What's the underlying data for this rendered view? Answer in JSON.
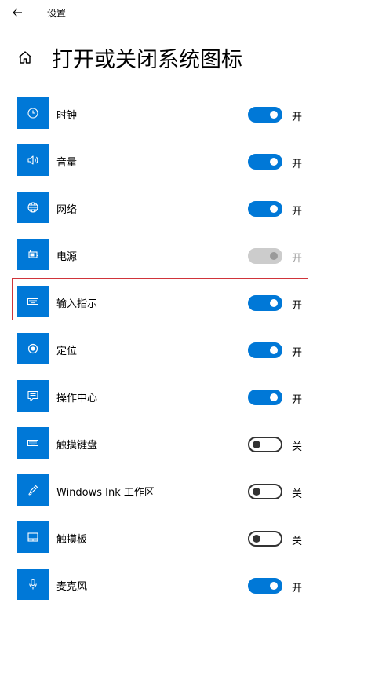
{
  "window": {
    "title": "设置"
  },
  "page": {
    "title": "打开或关闭系统图标"
  },
  "colors": {
    "accent": "#0078d7",
    "selection_border": "#d0343a",
    "disabled": "#cccccc"
  },
  "items": [
    {
      "label": "时钟",
      "icon": "clock-icon",
      "on": true,
      "disabled": false,
      "state": "开"
    },
    {
      "label": "音量",
      "icon": "volume-icon",
      "on": true,
      "disabled": false,
      "state": "开"
    },
    {
      "label": "网络",
      "icon": "network-globe-icon",
      "on": true,
      "disabled": false,
      "state": "开"
    },
    {
      "label": "电源",
      "icon": "battery-power-icon",
      "on": true,
      "disabled": true,
      "state": "开"
    },
    {
      "label": "输入指示",
      "icon": "keyboard-icon",
      "on": true,
      "disabled": false,
      "state": "开",
      "selected": true
    },
    {
      "label": "定位",
      "icon": "location-icon",
      "on": true,
      "disabled": false,
      "state": "开"
    },
    {
      "label": "操作中心",
      "icon": "action-center-icon",
      "on": true,
      "disabled": false,
      "state": "开"
    },
    {
      "label": "触摸键盘",
      "icon": "touch-keyboard-icon",
      "on": false,
      "disabled": false,
      "state": "关"
    },
    {
      "label": "Windows Ink 工作区",
      "icon": "windows-ink-pen-icon",
      "on": false,
      "disabled": false,
      "state": "关"
    },
    {
      "label": "触摸板",
      "icon": "touchpad-icon",
      "on": false,
      "disabled": false,
      "state": "关"
    },
    {
      "label": "麦克风",
      "icon": "microphone-icon",
      "on": true,
      "disabled": false,
      "state": "开"
    }
  ]
}
